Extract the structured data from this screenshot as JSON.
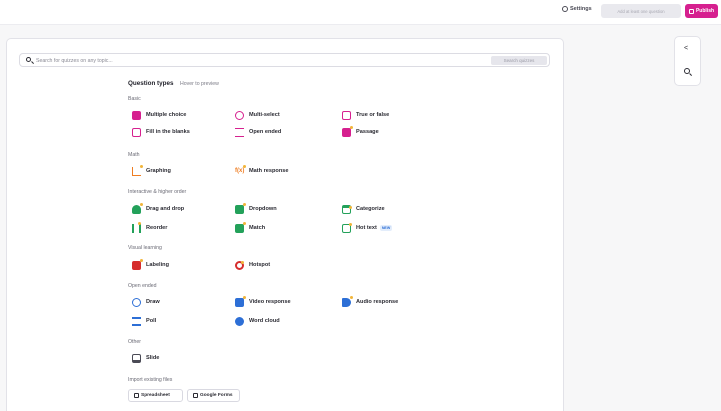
{
  "topbar": {
    "settings_label": "Settings",
    "add_question_label": "Add at least one question",
    "publish_label": "Publish",
    "publish_color": "#d6208f"
  },
  "search": {
    "placeholder": "Search for quizzes on any topic...",
    "button_label": "Search quizzes"
  },
  "question_types": {
    "title": "Question types",
    "hover_hint": "Hover to preview"
  },
  "sections": {
    "basic": "Basic",
    "math": "Math",
    "interactive": "Interactive & higher order",
    "visual": "Visual learning",
    "open_ended": "Open ended",
    "other": "Other",
    "import": "Import existing files"
  },
  "items": {
    "multiple_choice": {
      "label": "Multiple choice",
      "icon": "checkbox-icon",
      "color": "#d6208f"
    },
    "multi_select": {
      "label": "Multi-select",
      "icon": "double-check-icon",
      "color": "#d6208f"
    },
    "true_false": {
      "label": "True or false",
      "icon": "true-false-icon",
      "color": "#d6208f"
    },
    "fill_blanks": {
      "label": "Fill in the blanks",
      "icon": "fill-blank-icon",
      "color": "#d6208f"
    },
    "open_ended": {
      "label": "Open ended",
      "icon": "lines-icon",
      "color": "#d6208f"
    },
    "passage": {
      "label": "Passage",
      "icon": "document-icon",
      "color": "#d6208f"
    },
    "graphing": {
      "label": "Graphing",
      "icon": "graph-icon",
      "color": "#ef7d22"
    },
    "math_response": {
      "label": "Math response",
      "icon": "fx-icon",
      "color": "#ef7d22"
    },
    "drag_drop": {
      "label": "Drag and drop",
      "icon": "hand-icon",
      "color": "#23a15a"
    },
    "dropdown": {
      "label": "Dropdown",
      "icon": "dropdown-icon",
      "color": "#23a15a"
    },
    "categorize": {
      "label": "Categorize",
      "icon": "columns-icon",
      "color": "#23a15a"
    },
    "reorder": {
      "label": "Reorder",
      "icon": "reorder-icon",
      "color": "#23a15a"
    },
    "match": {
      "label": "Match",
      "icon": "match-icon",
      "color": "#23a15a"
    },
    "hot_text": {
      "label": "Hot text",
      "icon": "hot-text-icon",
      "color": "#23a15a",
      "badge": "NEW"
    },
    "labeling": {
      "label": "Labeling",
      "icon": "label-icon",
      "color": "#d62d2d"
    },
    "hotspot": {
      "label": "Hotspot",
      "icon": "target-icon",
      "color": "#d62d2d"
    },
    "draw": {
      "label": "Draw",
      "icon": "pencil-icon",
      "color": "#2d6fd6"
    },
    "video_response": {
      "label": "Video response",
      "icon": "video-icon",
      "color": "#2d6fd6"
    },
    "audio_response": {
      "label": "Audio response",
      "icon": "speaker-icon",
      "color": "#2d6fd6"
    },
    "poll": {
      "label": "Poll",
      "icon": "poll-icon",
      "color": "#2d6fd6"
    },
    "word_cloud": {
      "label": "Word cloud",
      "icon": "cloud-icon",
      "color": "#2d6fd6"
    },
    "slide": {
      "label": "Slide",
      "icon": "monitor-icon",
      "color": "#4a4a55"
    }
  },
  "import": {
    "spreadsheet_label": "Spreadsheet",
    "google_forms_label": "Google Forms"
  },
  "right_panel": {
    "share_icon": "share-icon",
    "search_icon": "search-icon"
  }
}
